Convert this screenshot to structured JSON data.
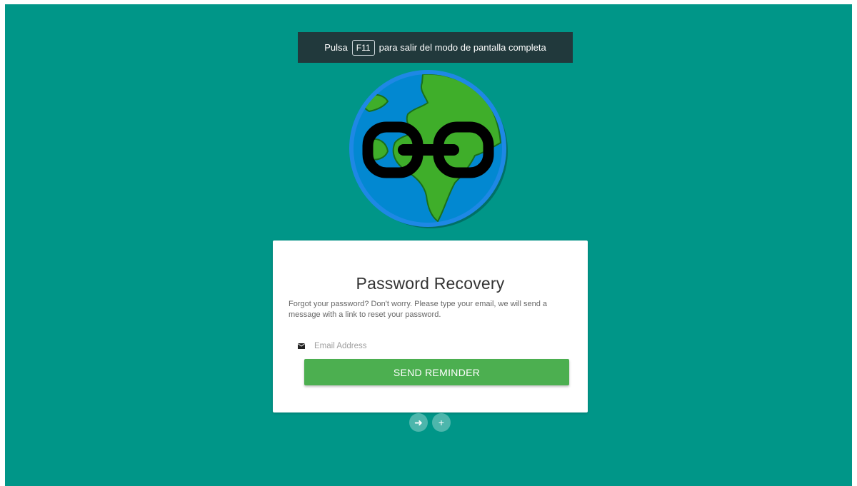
{
  "fullscreen_notice": {
    "prefix": "Pulsa",
    "key": "F11",
    "suffix": "para salir del modo de pantalla completa"
  },
  "logo": {
    "icon": "globe-chain-icon"
  },
  "recovery": {
    "title": "Password Recovery",
    "description": "Forgot your password? Don't worry. Please type your email, we will send a message with a link to reset your password.",
    "email": {
      "placeholder": "Email Address",
      "value": "",
      "icon": "mail-icon"
    },
    "submit_label": "SEND REMINDER"
  },
  "actions": {
    "login_icon": "arrow-right-icon",
    "login_glyph": "➜",
    "register_icon": "plus-icon",
    "register_glyph": "+"
  },
  "colors": {
    "background": "#009688",
    "button": "#4caf50",
    "fab": "#4db6ac",
    "toast": "#21393c"
  }
}
